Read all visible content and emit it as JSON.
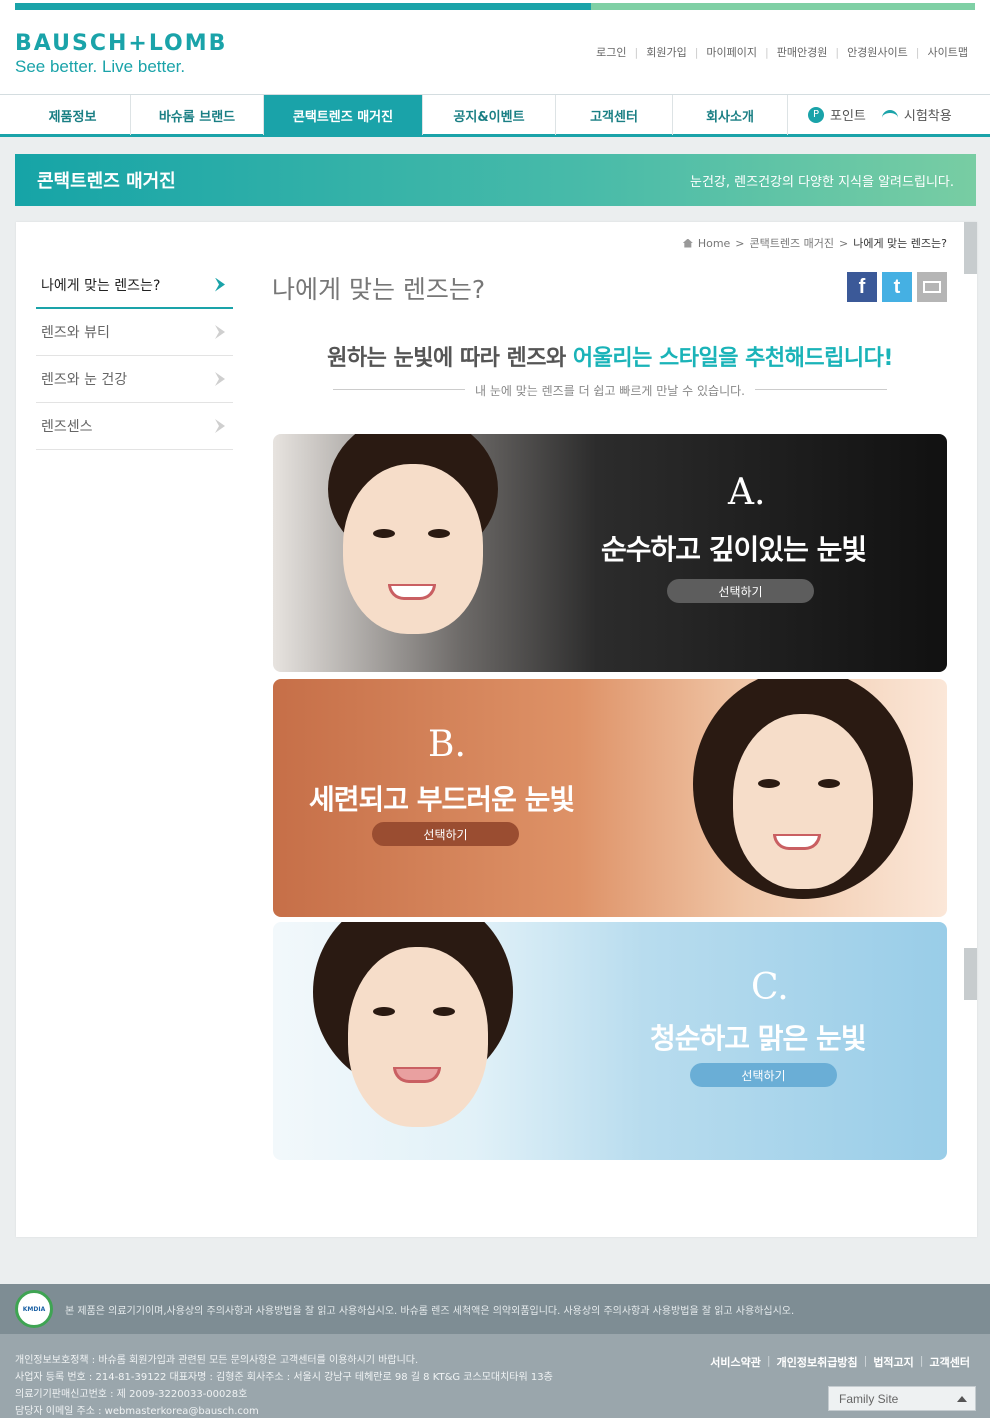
{
  "header": {
    "logo_main": "BAUSCH+LOMB",
    "logo_sub": "See better. Live better.",
    "util_nav": [
      "로그인",
      "회원가입",
      "마이페이지",
      "판매안경원",
      "안경원사이트",
      "사이트맵"
    ]
  },
  "gnb": {
    "tabs": [
      "제품정보",
      "바슈롬 브랜드",
      "콘택트렌즈 매거진",
      "공지&이벤트",
      "고객센터",
      "회사소개"
    ],
    "point_label": "포인트",
    "trial_label": "시험착용"
  },
  "banner": {
    "title": "콘택트렌즈 매거진",
    "desc": "눈건강, 렌즈건강의 다양한 지식을 알려드립니다."
  },
  "breadcrumb": {
    "home": "Home",
    "section": "콘택트렌즈 매거진",
    "current": "나에게 맞는 렌즈는?"
  },
  "lnb": {
    "items": [
      "나에게 맞는 렌즈는?",
      "렌즈와 뷰티",
      "렌즈와 눈 건강",
      "렌즈센스"
    ]
  },
  "content": {
    "title": "나에게 맞는 렌즈는?",
    "headline_pre": "원하는 눈빛에 따라 렌즈와 ",
    "headline_hl": "어울리는 스타일을 추천해드립니다!",
    "subline": "내 눈에 맞는 렌즈를 더 쉽고 빠르게 만날 수 있습니다."
  },
  "share": {
    "facebook": "f",
    "twitter": "t"
  },
  "cards": [
    {
      "letter": "A.",
      "title": "순수하고 깊이있는 눈빛",
      "button": "선택하기"
    },
    {
      "letter": "B.",
      "title": "세련되고 부드러운 눈빛",
      "button": "선택하기"
    },
    {
      "letter": "C.",
      "title": "청순하고 맑은 눈빛",
      "button": "선택하기"
    }
  ],
  "footer": {
    "badge": "KMDIA",
    "notice": "본 제품은 의료기기이며,사용상의 주의사항과 사용방법을 잘 읽고 사용하십시오. 바슈롬 렌즈 세척액은 의약외품입니다. 사용상의 주의사항과 사용방법을 잘 읽고 사용하십시오.",
    "info": [
      "개인정보보호정책 : 바슈롬 회원가입과 관련된 모든 문의사항은 고객센터를 이용하시기 바랍니다.",
      "사업자 등록 번호 : 214-81-39122 대표자명 : 김형준 회사주소 : 서울시 강남구 테헤란로 98 길 8 KT&G 코스모대치타워 13층",
      "의료기기판매신고번호 : 제 2009-3220033-00028호",
      "담당자 이메일 주소 : webmasterkorea@bausch.com"
    ],
    "links": [
      "서비스약관",
      "개인정보취급방침",
      "법적고지",
      "고객센터"
    ],
    "family_site": "Family Site"
  }
}
